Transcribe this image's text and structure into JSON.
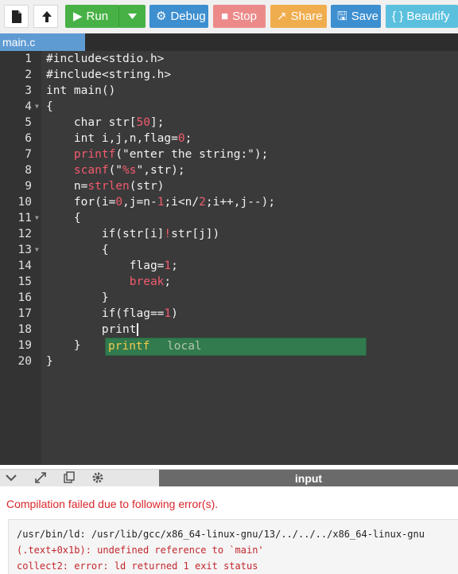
{
  "toolbar": {
    "run_label": "Run",
    "debug_label": "Debug",
    "stop_label": "Stop",
    "share_label": "Share",
    "save_label": "Save",
    "beautify_label": "{ } Beautify"
  },
  "tabs": {
    "file": "main.c"
  },
  "editor": {
    "lines": [
      {
        "n": "1",
        "fold": ""
      },
      {
        "n": "2",
        "fold": ""
      },
      {
        "n": "3",
        "fold": ""
      },
      {
        "n": "4",
        "fold": "▼"
      },
      {
        "n": "5",
        "fold": ""
      },
      {
        "n": "6",
        "fold": ""
      },
      {
        "n": "7",
        "fold": ""
      },
      {
        "n": "8",
        "fold": ""
      },
      {
        "n": "9",
        "fold": ""
      },
      {
        "n": "10",
        "fold": ""
      },
      {
        "n": "11",
        "fold": "▼"
      },
      {
        "n": "12",
        "fold": ""
      },
      {
        "n": "13",
        "fold": "▼"
      },
      {
        "n": "14",
        "fold": ""
      },
      {
        "n": "15",
        "fold": ""
      },
      {
        "n": "16",
        "fold": ""
      },
      {
        "n": "17",
        "fold": ""
      },
      {
        "n": "18",
        "fold": ""
      },
      {
        "n": "19",
        "fold": ""
      },
      {
        "n": "20",
        "fold": ""
      }
    ],
    "code": {
      "l1": "#include<stdio.h>",
      "l2": "#include<string.h>",
      "l3": "int main()",
      "l4": "{",
      "l5a": "    char str[",
      "l5b": "50",
      "l5c": "];",
      "l6a": "    int i,j,n,flag=",
      "l6b": "0",
      "l6c": ";",
      "l7a": "    ",
      "l7b": "printf",
      "l7c": "(\"enter the string:\");",
      "l8a": "    ",
      "l8b": "scanf",
      "l8c": "(\"",
      "l8d": "%s",
      "l8e": "\",str);",
      "l9a": "    n=",
      "l9b": "strlen",
      "l9c": "(str)",
      "l10a": "    for(i=",
      "l10b": "0",
      "l10c": ",j=n-",
      "l10d": "1",
      "l10e": ";i<n/",
      "l10f": "2",
      "l10g": ";i++,j--);",
      "l11": "    {",
      "l12a": "        if(str[i]",
      "l12b": "!",
      "l12c": "str[j])",
      "l13": "        {",
      "l14a": "            flag=",
      "l14b": "1",
      "l14c": ";",
      "l15a": "            ",
      "l15b": "break",
      "l15c": ";",
      "l16": "        }",
      "l17a": "        if(flag==",
      "l17b": "1",
      "l17c": ")",
      "l18": "        print",
      "l19": "    }",
      "l20": "}"
    },
    "autocomplete": {
      "word": "printf",
      "meta": "local"
    }
  },
  "panel": {
    "input_tab": "input"
  },
  "output": {
    "title": "Compilation failed due to following error(s).",
    "lines": [
      "/usr/bin/ld: /usr/lib/gcc/x86_64-linux-gnu/13/../../../x86_64-linux-gnu",
      "(.text+0x1b): undefined reference to `main'",
      "collect2: error: ld returned 1 exit status"
    ]
  },
  "colors": {
    "run": "#48b146",
    "debug": "#3d8fd0",
    "stop": "#ec8a8a",
    "share": "#f0ad4e",
    "save": "#3d8fd0",
    "beautify": "#5bc0de",
    "error": "#d9262b"
  }
}
